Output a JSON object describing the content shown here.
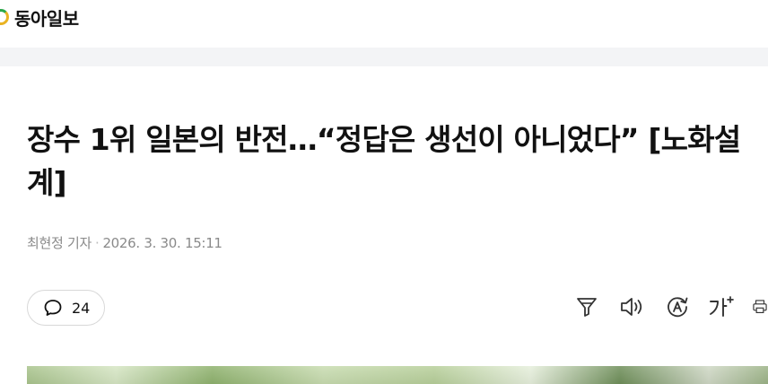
{
  "site": {
    "name": "동아일보",
    "logo_icon": "donga-logo-icon"
  },
  "article": {
    "title": "장수 1위 일본의 반전…“정답은 생선이 아니었다” [노화설계]",
    "author": "최현정 기자",
    "separator": "·",
    "timestamp": "2026. 3. 30. 15:11"
  },
  "toolbar": {
    "comment_count": "24",
    "tools": [
      "filter-icon",
      "speaker-icon",
      "translate-icon",
      "font-size-icon",
      "print-icon"
    ]
  },
  "colors": {
    "accent_green": "#2aa84a",
    "accent_yellow": "#e9b323",
    "meta_gray": "#8a8a8a",
    "band": "#f3f4f6"
  }
}
